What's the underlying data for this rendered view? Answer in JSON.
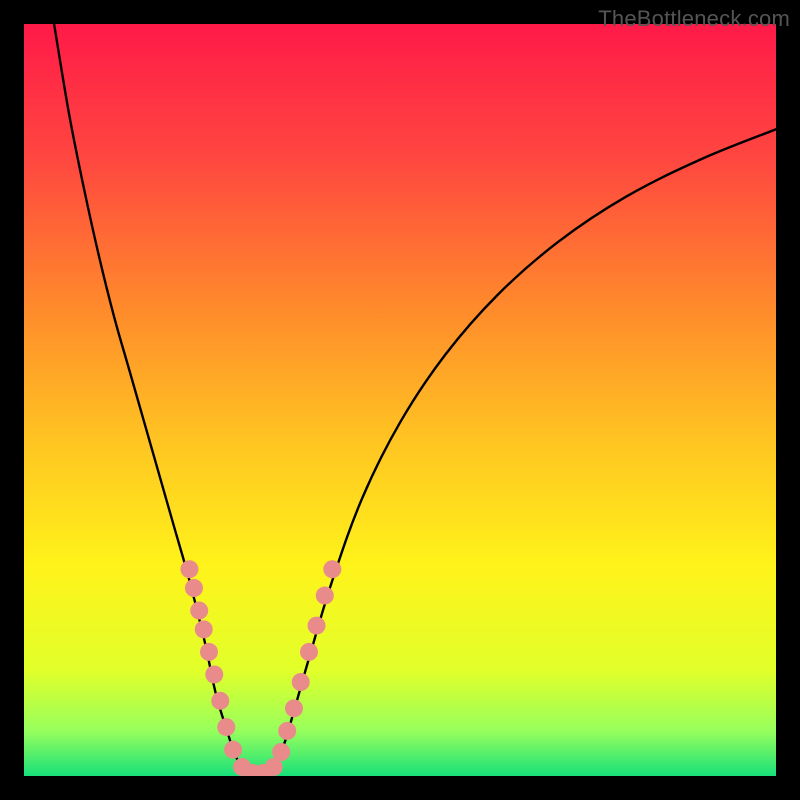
{
  "watermark": {
    "text": "TheBottleneck.com"
  },
  "chart_data": {
    "type": "line",
    "title": "",
    "xlabel": "",
    "ylabel": "",
    "xlim": [
      0,
      100
    ],
    "ylim": [
      0,
      100
    ],
    "background_gradient": {
      "type": "vertical",
      "stops": [
        {
          "pos": 0.0,
          "color": "#ff1a48"
        },
        {
          "pos": 0.18,
          "color": "#ff4740"
        },
        {
          "pos": 0.38,
          "color": "#ff8b2b"
        },
        {
          "pos": 0.55,
          "color": "#ffc322"
        },
        {
          "pos": 0.72,
          "color": "#fff31a"
        },
        {
          "pos": 0.86,
          "color": "#e1ff2a"
        },
        {
          "pos": 0.94,
          "color": "#97ff5c"
        },
        {
          "pos": 1.0,
          "color": "#18e07a"
        }
      ]
    },
    "series": [
      {
        "name": "left-arm",
        "color": "#000000",
        "x": [
          4,
          6,
          8,
          10,
          12,
          14,
          16,
          18,
          20,
          22,
          24,
          25.5,
          27,
          28,
          29
        ],
        "y": [
          100,
          88,
          78,
          69,
          61,
          54,
          47,
          40,
          33,
          26,
          18,
          11,
          6,
          3,
          1
        ]
      },
      {
        "name": "right-arm",
        "color": "#000000",
        "x": [
          33,
          34.5,
          36,
          38,
          41,
          45,
          50,
          56,
          63,
          71,
          80,
          90,
          100
        ],
        "y": [
          1,
          4,
          9,
          16,
          26,
          37,
          47,
          56,
          64,
          71,
          77,
          82,
          86
        ]
      },
      {
        "name": "valley-floor",
        "color": "#000000",
        "x": [
          29,
          30,
          31,
          32,
          33
        ],
        "y": [
          1,
          0.3,
          0.1,
          0.3,
          1
        ]
      }
    ],
    "markers": {
      "name": "highlight-dots",
      "color": "#e98b8b",
      "radius_px": 9,
      "points": [
        {
          "x": 22.0,
          "y": 27.5
        },
        {
          "x": 22.6,
          "y": 25.0
        },
        {
          "x": 23.3,
          "y": 22.0
        },
        {
          "x": 23.9,
          "y": 19.5
        },
        {
          "x": 24.6,
          "y": 16.5
        },
        {
          "x": 25.3,
          "y": 13.5
        },
        {
          "x": 26.1,
          "y": 10.0
        },
        {
          "x": 26.9,
          "y": 6.5
        },
        {
          "x": 27.8,
          "y": 3.5
        },
        {
          "x": 29.0,
          "y": 1.2
        },
        {
          "x": 30.4,
          "y": 0.4
        },
        {
          "x": 31.8,
          "y": 0.4
        },
        {
          "x": 33.2,
          "y": 1.2
        },
        {
          "x": 34.2,
          "y": 3.2
        },
        {
          "x": 35.0,
          "y": 6.0
        },
        {
          "x": 35.9,
          "y": 9.0
        },
        {
          "x": 36.8,
          "y": 12.5
        },
        {
          "x": 37.9,
          "y": 16.5
        },
        {
          "x": 38.9,
          "y": 20.0
        },
        {
          "x": 40.0,
          "y": 24.0
        },
        {
          "x": 41.0,
          "y": 27.5
        }
      ]
    }
  }
}
